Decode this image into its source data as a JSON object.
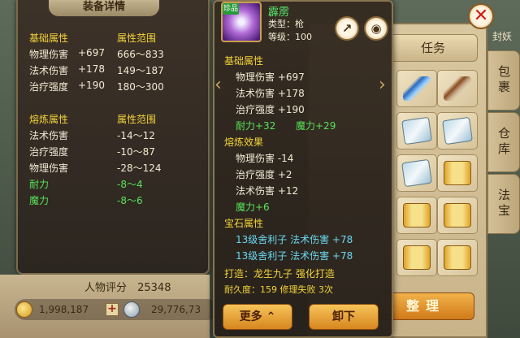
{
  "left_panel": {
    "title": "装备详情",
    "base_header": "基础属性",
    "range_header": "属性范围",
    "base_rows": [
      {
        "name": "物理伤害",
        "value": "+697",
        "range": "666～833"
      },
      {
        "name": "法术伤害",
        "value": "+178",
        "range": "149～187"
      },
      {
        "name": "治疗强度",
        "value": "+190",
        "range": "180～300"
      }
    ],
    "refine_header": "熔炼属性",
    "refine_range_header": "属性范围",
    "refine_rows": [
      {
        "name": "法术伤害",
        "range": "-14～12"
      },
      {
        "name": "治疗强度",
        "range": "-10～87"
      },
      {
        "name": "物理伤害",
        "range": "-28～124"
      }
    ],
    "refine_green_rows": [
      {
        "name": "耐力",
        "range": "-8～4"
      },
      {
        "name": "魔力",
        "range": "-8～6"
      }
    ],
    "score_label": "人物评分",
    "score_value": "25348",
    "gold": "1,998,187",
    "silver": "29,776,73"
  },
  "item": {
    "badge": "珍品",
    "name": "霹雳",
    "type": "类型：枪",
    "level": "等级：100",
    "base_header": "基础属性",
    "base_rows": [
      "物理伤害 +697",
      "法术伤害 +178",
      "治疗强度 +190"
    ],
    "base_green": [
      "耐力+32",
      "魔力+29"
    ],
    "refine_header": "熔炼效果",
    "refine_rows": [
      "物理伤害 -14",
      "治疗强度 +2",
      "法术伤害 +12"
    ],
    "refine_green": "魔力+6",
    "gem_header": "宝石属性",
    "gem_rows": [
      "13级舍利子 法术伤害 +78",
      "13级舍利子 法术伤害 +78"
    ],
    "forge": "打造：龙生九子   强化打造",
    "durability": "耐久度：159 修理失败 3次",
    "more_button": "更多",
    "unequip_button": "卸下",
    "share_icon": "share-icon",
    "eye_icon": "eye-icon"
  },
  "inventory": {
    "task_tab": "任务",
    "side_tabs": [
      "包裹",
      "仓库",
      "法宝"
    ],
    "sort_button": "整理",
    "seal_text": "封妖",
    "close_icon": "close-icon"
  }
}
